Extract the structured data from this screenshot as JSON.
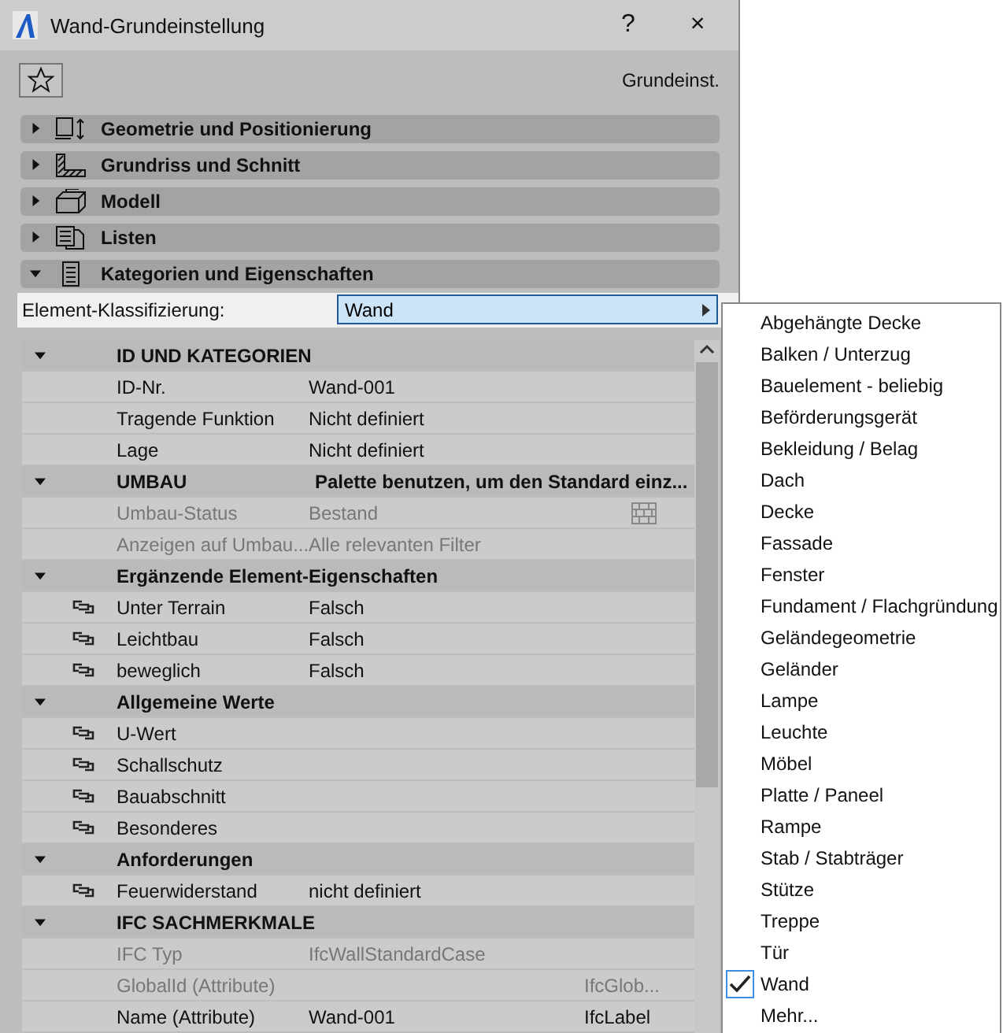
{
  "window": {
    "title": "Wand-Grundeinstellung",
    "help": "?",
    "close": "×"
  },
  "toolbar": {
    "favorite_label": "Grundeinst."
  },
  "panels": [
    {
      "label": "Geometrie und Positionierung",
      "expanded": false
    },
    {
      "label": "Grundriss und Schnitt",
      "expanded": false
    },
    {
      "label": "Modell",
      "expanded": false
    },
    {
      "label": "Listen",
      "expanded": false
    },
    {
      "label": "Kategorien und Eigenschaften",
      "expanded": true
    }
  ],
  "classification": {
    "label": "Element-Klassifizierung:",
    "value": "Wand"
  },
  "table": {
    "rows": [
      {
        "kind": "group",
        "expanded": true,
        "label": "ID UND KATEGORIEN"
      },
      {
        "kind": "item",
        "label": "ID-Nr.",
        "value": "Wand-001",
        "linked": false,
        "disabled": false
      },
      {
        "kind": "item",
        "label": "Tragende Funktion",
        "value": "Nicht definiert",
        "linked": false,
        "disabled": false
      },
      {
        "kind": "item",
        "label": "Lage",
        "value": "Nicht definiert",
        "linked": false,
        "disabled": false
      },
      {
        "kind": "group",
        "expanded": true,
        "label": "UMBAU",
        "value": "Palette benutzen, um den Standard einz..."
      },
      {
        "kind": "item",
        "label": "Umbau-Status",
        "value": "Bestand",
        "linked": false,
        "disabled": true,
        "brick": true
      },
      {
        "kind": "item",
        "label": "Anzeigen auf Umbau...",
        "value": "Alle relevanten Filter",
        "linked": false,
        "disabled": true
      },
      {
        "kind": "group",
        "expanded": true,
        "label": "Ergänzende Element-Eigenschaften"
      },
      {
        "kind": "item",
        "label": "Unter Terrain",
        "value": "Falsch",
        "linked": true,
        "disabled": false
      },
      {
        "kind": "item",
        "label": "Leichtbau",
        "value": "Falsch",
        "linked": true,
        "disabled": false
      },
      {
        "kind": "item",
        "label": "beweglich",
        "value": "Falsch",
        "linked": true,
        "disabled": false
      },
      {
        "kind": "group",
        "expanded": true,
        "label": "Allgemeine Werte"
      },
      {
        "kind": "item",
        "label": "U-Wert",
        "linked": true,
        "disabled": false
      },
      {
        "kind": "item",
        "label": "Schallschutz",
        "linked": true,
        "disabled": false
      },
      {
        "kind": "item",
        "label": "Bauabschnitt",
        "linked": true,
        "disabled": false
      },
      {
        "kind": "item",
        "label": "Besonderes",
        "linked": true,
        "disabled": false
      },
      {
        "kind": "group",
        "expanded": true,
        "label": "Anforderungen"
      },
      {
        "kind": "item",
        "label": "Feuerwiderstand",
        "value": "nicht definiert",
        "linked": true,
        "disabled": false
      },
      {
        "kind": "group",
        "expanded": true,
        "label": "IFC SACHMERKMALE"
      },
      {
        "kind": "item",
        "label": "IFC Typ",
        "value": "IfcWallStandardCase",
        "linked": false,
        "disabled": true
      },
      {
        "kind": "item",
        "label": "GlobalId (Attribute)",
        "type": "IfcGlob...",
        "linked": false,
        "disabled": true
      },
      {
        "kind": "item",
        "label": "Name (Attribute)",
        "value": "Wand-001",
        "type": "IfcLabel",
        "linked": false,
        "disabled": false
      }
    ]
  },
  "menu": {
    "items": [
      {
        "label": "Abgehängte Decke",
        "selected": false
      },
      {
        "label": "Balken / Unterzug",
        "selected": false
      },
      {
        "label": "Bauelement - beliebig",
        "selected": false
      },
      {
        "label": "Beförderungsgerät",
        "selected": false
      },
      {
        "label": "Bekleidung / Belag",
        "selected": false
      },
      {
        "label": "Dach",
        "selected": false
      },
      {
        "label": "Decke",
        "selected": false
      },
      {
        "label": "Fassade",
        "selected": false
      },
      {
        "label": "Fenster",
        "selected": false
      },
      {
        "label": "Fundament / Flachgründung",
        "selected": false
      },
      {
        "label": "Geländegeometrie",
        "selected": false
      },
      {
        "label": "Geländer",
        "selected": false
      },
      {
        "label": "Lampe",
        "selected": false
      },
      {
        "label": "Leuchte",
        "selected": false
      },
      {
        "label": "Möbel",
        "selected": false
      },
      {
        "label": "Platte / Paneel",
        "selected": false
      },
      {
        "label": "Rampe",
        "selected": false
      },
      {
        "label": "Stab / Stabträger",
        "selected": false
      },
      {
        "label": "Stütze",
        "selected": false
      },
      {
        "label": "Treppe",
        "selected": false
      },
      {
        "label": "Tür",
        "selected": false
      },
      {
        "label": "Wand",
        "selected": true
      },
      {
        "label": "Mehr...",
        "selected": false
      }
    ]
  }
}
